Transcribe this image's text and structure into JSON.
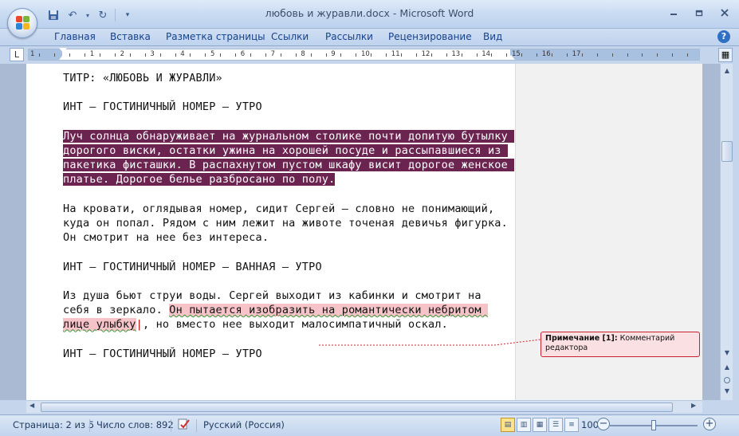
{
  "window": {
    "title": "любовь и журавли.docx - Microsoft Word",
    "minimize_icon": "minimize-icon",
    "maximize_icon": "restore-icon",
    "close_icon": "close-icon"
  },
  "quick_access": [
    "save-icon",
    "undo-icon",
    "redo-icon",
    "customize-icon"
  ],
  "ribbon_tabs": [
    "Главная",
    "Вставка",
    "Разметка страницы",
    "Ссылки",
    "Рассылки",
    "Рецензирование",
    "Вид"
  ],
  "ruler": {
    "numbers": [
      "1",
      "1",
      "2",
      "3",
      "4",
      "5",
      "6",
      "7",
      "8",
      "9",
      "10",
      "11",
      "12",
      "13",
      "14",
      "15",
      "16",
      "17"
    ],
    "tab_selector": "L"
  },
  "document": {
    "paragraphs": {
      "p1": "ТИТР: «ЛЮБОВЬ И ЖУРАВЛИ»",
      "p2": "ИНТ – ГОСТИНИЧНЫЙ НОМЕР – УТРО",
      "p3": "Луч солнца обнаруживает на журнальном столике почти допитую бутылку дорогого виски, остатки ужина на хорошей посуде и рассыпавшиеся из пакетика фисташки. В распахнутом пустом шкафу висит дорогое женское платье. Дорогое белье разбросано по полу.",
      "p4": "На кровати, оглядывая номер, сидит Сергей – словно не понимающий, куда он попал. Рядом с ним лежит на животе точеная девичья фигурка. Он смотрит на нее без интереса.",
      "p5": "ИНТ – ГОСТИНИЧНЫЙ НОМЕР – ВАННАЯ – УТРО",
      "p6_before": "Из душа бьют струи воды. Сергей выходит из кабинки и смотрит на себя в зеркало. ",
      "p6_comment": "Он пытается изобразить на романтически небритом лице улыбку",
      "p6_after": ", но вместо нее выходит малосимпатичный оскал.",
      "p7": "ИНТ – ГОСТИНИЧНЫЙ НОМЕР – УТРО"
    },
    "comment": {
      "label": "Примечание [1]:",
      "text": "Комментарий редактора"
    }
  },
  "status_bar": {
    "page": "Страница: 2 из 5",
    "words": "Число слов: 892",
    "language": "Русский (Россия)",
    "zoom": "100%",
    "zoom_level_percent": 100
  },
  "colors": {
    "selection": "#6b2350",
    "comment_highlight": "#f6c4c8",
    "comment_border": "#c8222f",
    "ribbon_text": "#15428b"
  }
}
